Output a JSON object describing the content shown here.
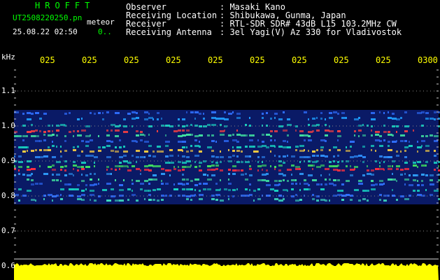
{
  "header": {
    "app_name": "HROFFT",
    "file_name": "UT2508220250.pn",
    "meteor_label": "meteor",
    "date_time": "25.08.22 02:50",
    "count": "0..",
    "info": [
      {
        "label": "Observer",
        "value": ": Masaki Kano"
      },
      {
        "label": "Receiving Location",
        "value": ": Shibukawa, Gunma, Japan"
      },
      {
        "label": "Receiver",
        "value": ": RTL-SDR SDR# 43dB L15 103.2MHz CW"
      },
      {
        "label": "Receiving Antenna",
        "value": ": 3el Yagi(V) Az 330 for Vladivostok"
      }
    ]
  },
  "axes": {
    "y_unit": "kHz",
    "y_ticks": [
      "1.1",
      "1.0",
      "0.9",
      "0.8",
      "0.7",
      "0.6"
    ],
    "x_ticks": [
      "025",
      "025",
      "025",
      "025",
      "025",
      "025",
      "025",
      "025",
      "025",
      "0300"
    ]
  },
  "colors": {
    "background": "#000000",
    "header_text": "#ffffff",
    "app_name": "#00ff00",
    "file_name": "#00ff00",
    "tick_label": "#ffff00",
    "meteor_label": "#ffffff",
    "grid": "#888888",
    "noise_bar": "#ffff00",
    "count": "#00ff00"
  }
}
